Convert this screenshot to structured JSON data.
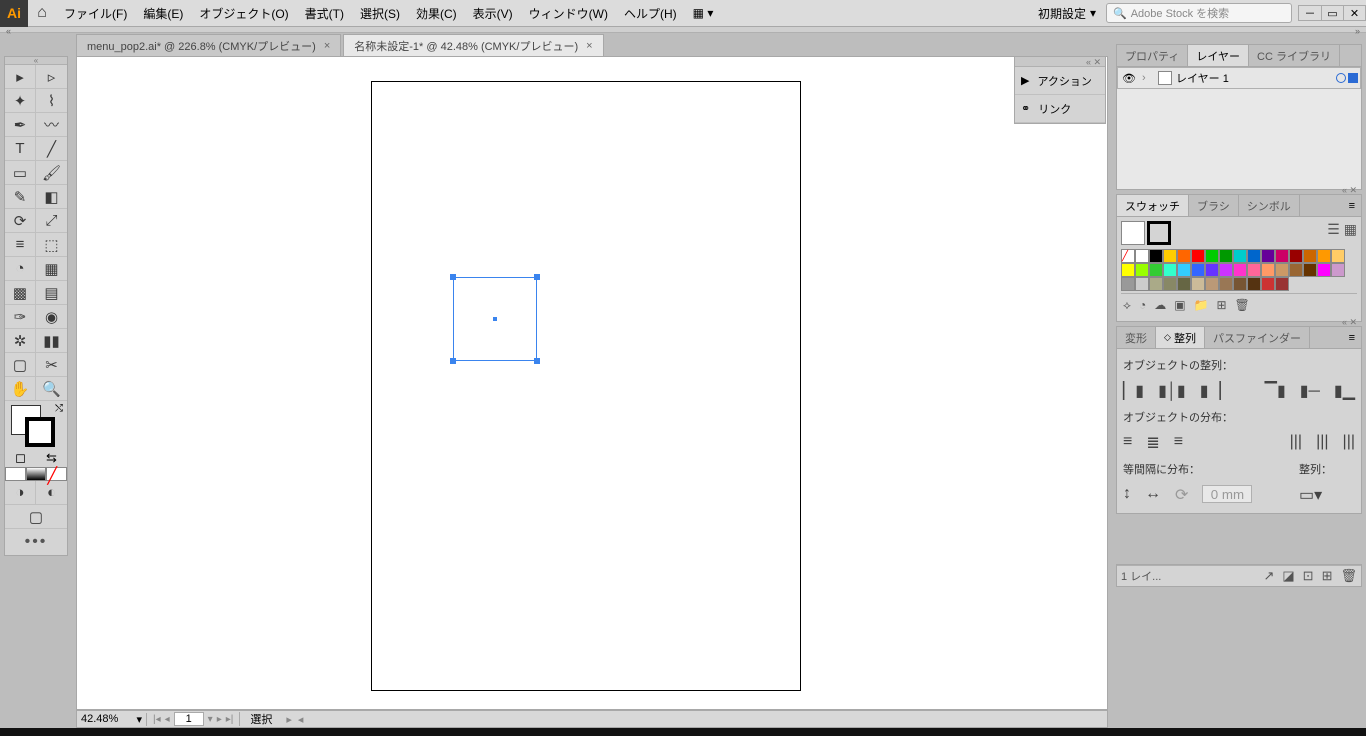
{
  "app": {
    "logo_text": "Ai"
  },
  "menu": {
    "file": "ファイル(F)",
    "edit": "編集(E)",
    "object": "オブジェクト(O)",
    "format": "書式(T)",
    "select": "選択(S)",
    "effect": "効果(C)",
    "view": "表示(V)",
    "window": "ウィンドウ(W)",
    "help": "ヘルプ(H)"
  },
  "workspace": {
    "label": "初期設定"
  },
  "search": {
    "placeholder": "Adobe Stock を検索"
  },
  "tabs": {
    "t1": "menu_pop2.ai* @ 226.8% (CMYK/プレビュー)",
    "t2": "名称未設定-1* @ 42.48% (CMYK/プレビュー)"
  },
  "status": {
    "zoom": "42.48%",
    "page": "1",
    "tool": "選択"
  },
  "actions_panel": {
    "actions": "アクション",
    "links": "リンク"
  },
  "layers_panel": {
    "tab_properties": "プロパティ",
    "tab_layers": "レイヤー",
    "tab_cclib": "CC ライブラリ",
    "layer1": "レイヤー 1",
    "footer": "1 レイ..."
  },
  "swatches_panel": {
    "tab_swatch": "スウォッチ",
    "tab_brush": "ブラシ",
    "tab_symbol": "シンボル"
  },
  "align_panel": {
    "tab_transform": "変形",
    "tab_align": "整列",
    "tab_pathfinder": "パスファインダー",
    "h_align": "オブジェクトの整列：",
    "h_dist": "オブジェクトの分布：",
    "h_equal": "等間隔に分布：",
    "h_target": "整列：",
    "gap_value": "0 mm"
  },
  "swatch_colors": [
    "#ffffff",
    "#ffffff",
    "#000000",
    "#ffcc00",
    "#ff6600",
    "#ff0000",
    "#00cc00",
    "#009900",
    "#00cccc",
    "#0066cc",
    "#660099",
    "#cc0066",
    "#990000",
    "#cc6600",
    "#ff9900",
    "#ffcc66",
    "#ffff00",
    "#99ff00",
    "#33cc33",
    "#33ffcc",
    "#33ccff",
    "#3366ff",
    "#6633ff",
    "#cc33ff",
    "#ff33cc",
    "#ff6699",
    "#ff9966",
    "#cc9966",
    "#996633",
    "#663300",
    "#ff00ff",
    "#cc99cc",
    "#999999",
    "#cccccc",
    "#aaaa88",
    "#888866",
    "#666644",
    "#ccbb99",
    "#bb9977",
    "#997755",
    "#775533",
    "#553311",
    "#cc3333",
    "#993333"
  ]
}
